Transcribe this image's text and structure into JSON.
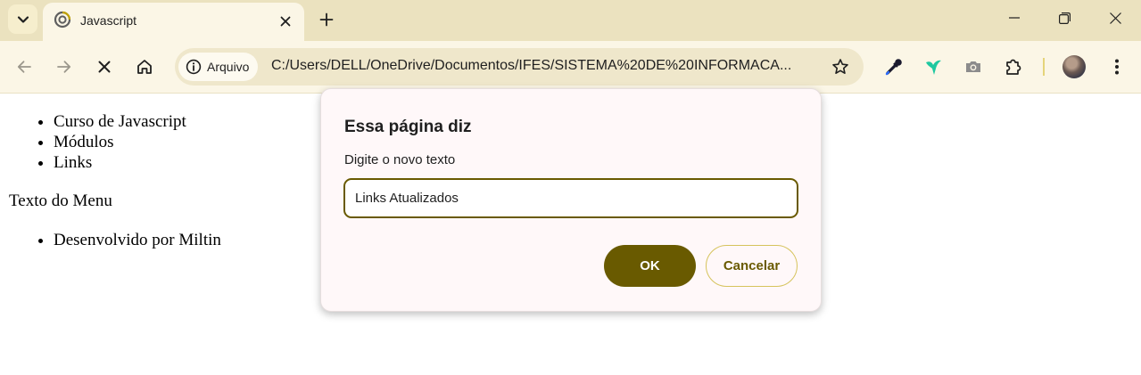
{
  "browser": {
    "tab": {
      "title": "Javascript"
    },
    "address": {
      "site_chip_label": "Arquivo",
      "url": "C:/Users/DELL/OneDrive/Documentos/IFES/SISTEMA%20DE%20INFORMACA..."
    },
    "colors": {
      "frame": "#ebe2bf",
      "toolbar": "#fbf6e6",
      "accent": "#695a00"
    }
  },
  "page": {
    "menu_items": [
      "Curso de Javascript",
      "Módulos",
      "Links"
    ],
    "menu_text": "Texto do Menu",
    "footer_items": [
      "Desenvolvido por Miltin"
    ]
  },
  "dialog": {
    "title": "Essa página diz",
    "message": "Digite o novo texto",
    "input_value": "Links Atualizados",
    "ok_label": "OK",
    "cancel_label": "Cancelar"
  }
}
